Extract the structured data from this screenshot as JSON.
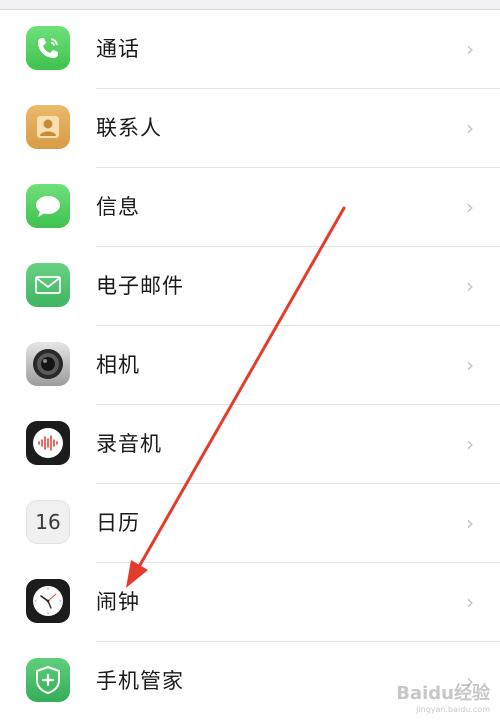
{
  "settings_list": {
    "items": [
      {
        "label": "通话",
        "icon": "phone-icon",
        "color": "#4cd964"
      },
      {
        "label": "联系人",
        "icon": "contacts-icon",
        "color": "#e2ad5b"
      },
      {
        "label": "信息",
        "icon": "messages-icon",
        "color": "#4cd964"
      },
      {
        "label": "电子邮件",
        "icon": "mail-icon",
        "color": "#58c677"
      },
      {
        "label": "相机",
        "icon": "camera-icon",
        "color": "#6a6a6a"
      },
      {
        "label": "录音机",
        "icon": "voice-recorder-icon",
        "color": "#1c1c1c"
      },
      {
        "label": "日历",
        "icon": "calendar-icon",
        "number": "16",
        "color": "#eeeeee"
      },
      {
        "label": "闹钟",
        "icon": "clock-icon",
        "color": "#1c1c1c"
      },
      {
        "label": "手机管家",
        "icon": "shield-icon",
        "color": "#46c06a"
      }
    ],
    "chevron": "›"
  },
  "annotation": {
    "arrow_color": "#e53b2c"
  },
  "watermark": {
    "main": "Baidu经验",
    "sub": "jingyan.baidu.com"
  }
}
